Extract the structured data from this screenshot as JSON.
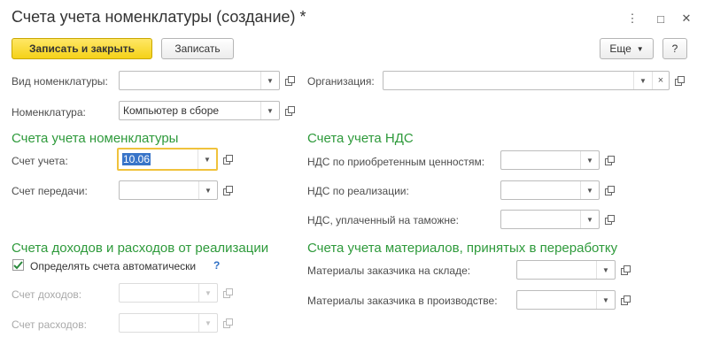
{
  "window": {
    "title": "Счета учета номенклатуры (создание) *",
    "controls": {
      "menu_icon": "⋮",
      "maximize_icon": "□",
      "close_icon": "✕"
    }
  },
  "toolbar": {
    "save_close_label": "Записать и закрыть",
    "save_label": "Записать",
    "more_label": "Еще",
    "help_label": "?"
  },
  "top_fields": {
    "item_type_label": "Вид номенклатуры:",
    "item_type_value": "",
    "item_label": "Номенклатура:",
    "item_value": "Компьютер в сборе",
    "organization_label": "Организация:",
    "organization_value": ""
  },
  "accounts": {
    "section_title": "Счета учета номенклатуры",
    "account_label": "Счет учета:",
    "account_value": "10.06",
    "transfer_label": "Счет передачи:",
    "transfer_value": ""
  },
  "vat": {
    "section_title": "Счета учета НДС",
    "purchased_label": "НДС по приобретенным ценностям:",
    "purchased_value": "",
    "sales_label": "НДС по реализации:",
    "sales_value": "",
    "customs_label": "НДС, уплаченный на таможне:",
    "customs_value": ""
  },
  "income": {
    "section_title": "Счета доходов и расходов от реализации",
    "auto_label": "Определять счета автоматически",
    "auto_checked": true,
    "help": "?",
    "income_label": "Счет доходов:",
    "income_value": "",
    "expense_label": "Счет расходов:",
    "expense_value": ""
  },
  "materials": {
    "section_title": "Счета учета материалов, принятых в переработку",
    "warehouse_label": "Материалы заказчика на складе:",
    "warehouse_value": "",
    "production_label": "Материалы заказчика в производстве:",
    "production_value": ""
  },
  "colors": {
    "section_green": "#2e9a3b",
    "primary_button": "#f5d218",
    "focus_border": "#f0c23c",
    "selection": "#3874c8"
  }
}
